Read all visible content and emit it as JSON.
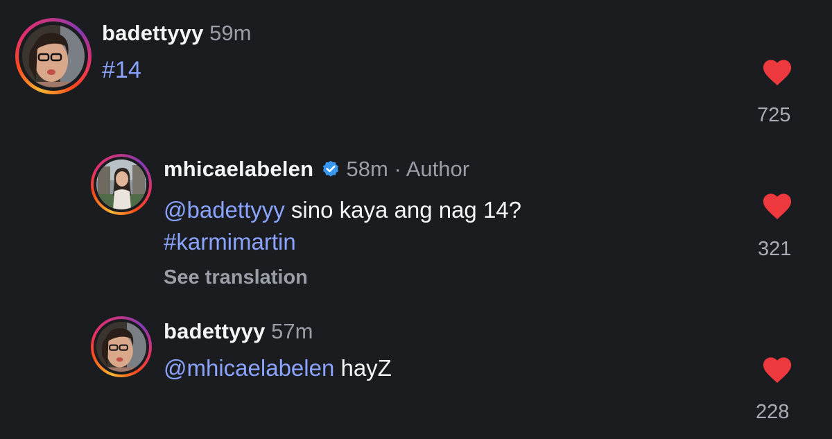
{
  "comments": [
    {
      "username": "badettyyy",
      "time": "59m",
      "text_parts": [
        {
          "type": "hashtag",
          "text": "#14"
        }
      ],
      "likes": "725",
      "liked": true
    },
    {
      "username": "mhicaelabelen",
      "verified": true,
      "time": "58m",
      "separator": "·",
      "badge": "Author",
      "mention": "@badettyyy",
      "text": " sino kaya ang nag 14?",
      "hashtag": "#karmimartin",
      "see_translation": "See translation",
      "likes": "321",
      "liked": true
    },
    {
      "username": "badettyyy",
      "time": "57m",
      "mention": "@mhicaelabelen",
      "text": " hayZ",
      "likes": "228",
      "liked": true
    }
  ],
  "colors": {
    "background": "#1a1c20",
    "mention": "#8aa4ff",
    "heart": "#ee3a3f",
    "verified": "#3897f0",
    "muted": "#9a9ea6"
  },
  "icons": [
    "heart-icon",
    "verified-badge-icon"
  ]
}
